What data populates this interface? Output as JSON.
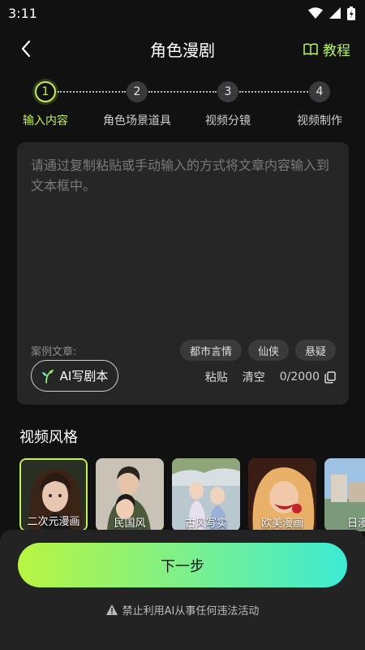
{
  "status_bar": {
    "time": "3:11"
  },
  "header": {
    "title": "角色漫剧",
    "tutorial_label": "教程"
  },
  "stepper": {
    "steps": [
      {
        "number": "1",
        "label": "输入内容"
      },
      {
        "number": "2",
        "label": "角色场景道具"
      },
      {
        "number": "3",
        "label": "视频分镜"
      },
      {
        "number": "4",
        "label": "视频制作"
      }
    ]
  },
  "editor": {
    "placeholder": "请通过复制粘贴或手动输入的方式将文章内容输入到文本框中。",
    "example_label": "案例文章:",
    "tags": [
      "都市言情",
      "仙侠",
      "悬疑"
    ],
    "ai_button_label": "AI写剧本",
    "paste_label": "粘贴",
    "clear_label": "清空",
    "char_count": "0/2000"
  },
  "video_style": {
    "title": "视频风格",
    "styles": [
      {
        "name": "二次元漫画"
      },
      {
        "name": "民国风"
      },
      {
        "name": "古风写实"
      },
      {
        "name": "欧美漫画"
      },
      {
        "name": "日漫"
      }
    ]
  },
  "bottom": {
    "next_label": "下一步",
    "warning": "禁止利用AI从事任何违法活动"
  },
  "colors": {
    "accent": "#c5f05d",
    "background": "#111111",
    "card": "#262627"
  }
}
